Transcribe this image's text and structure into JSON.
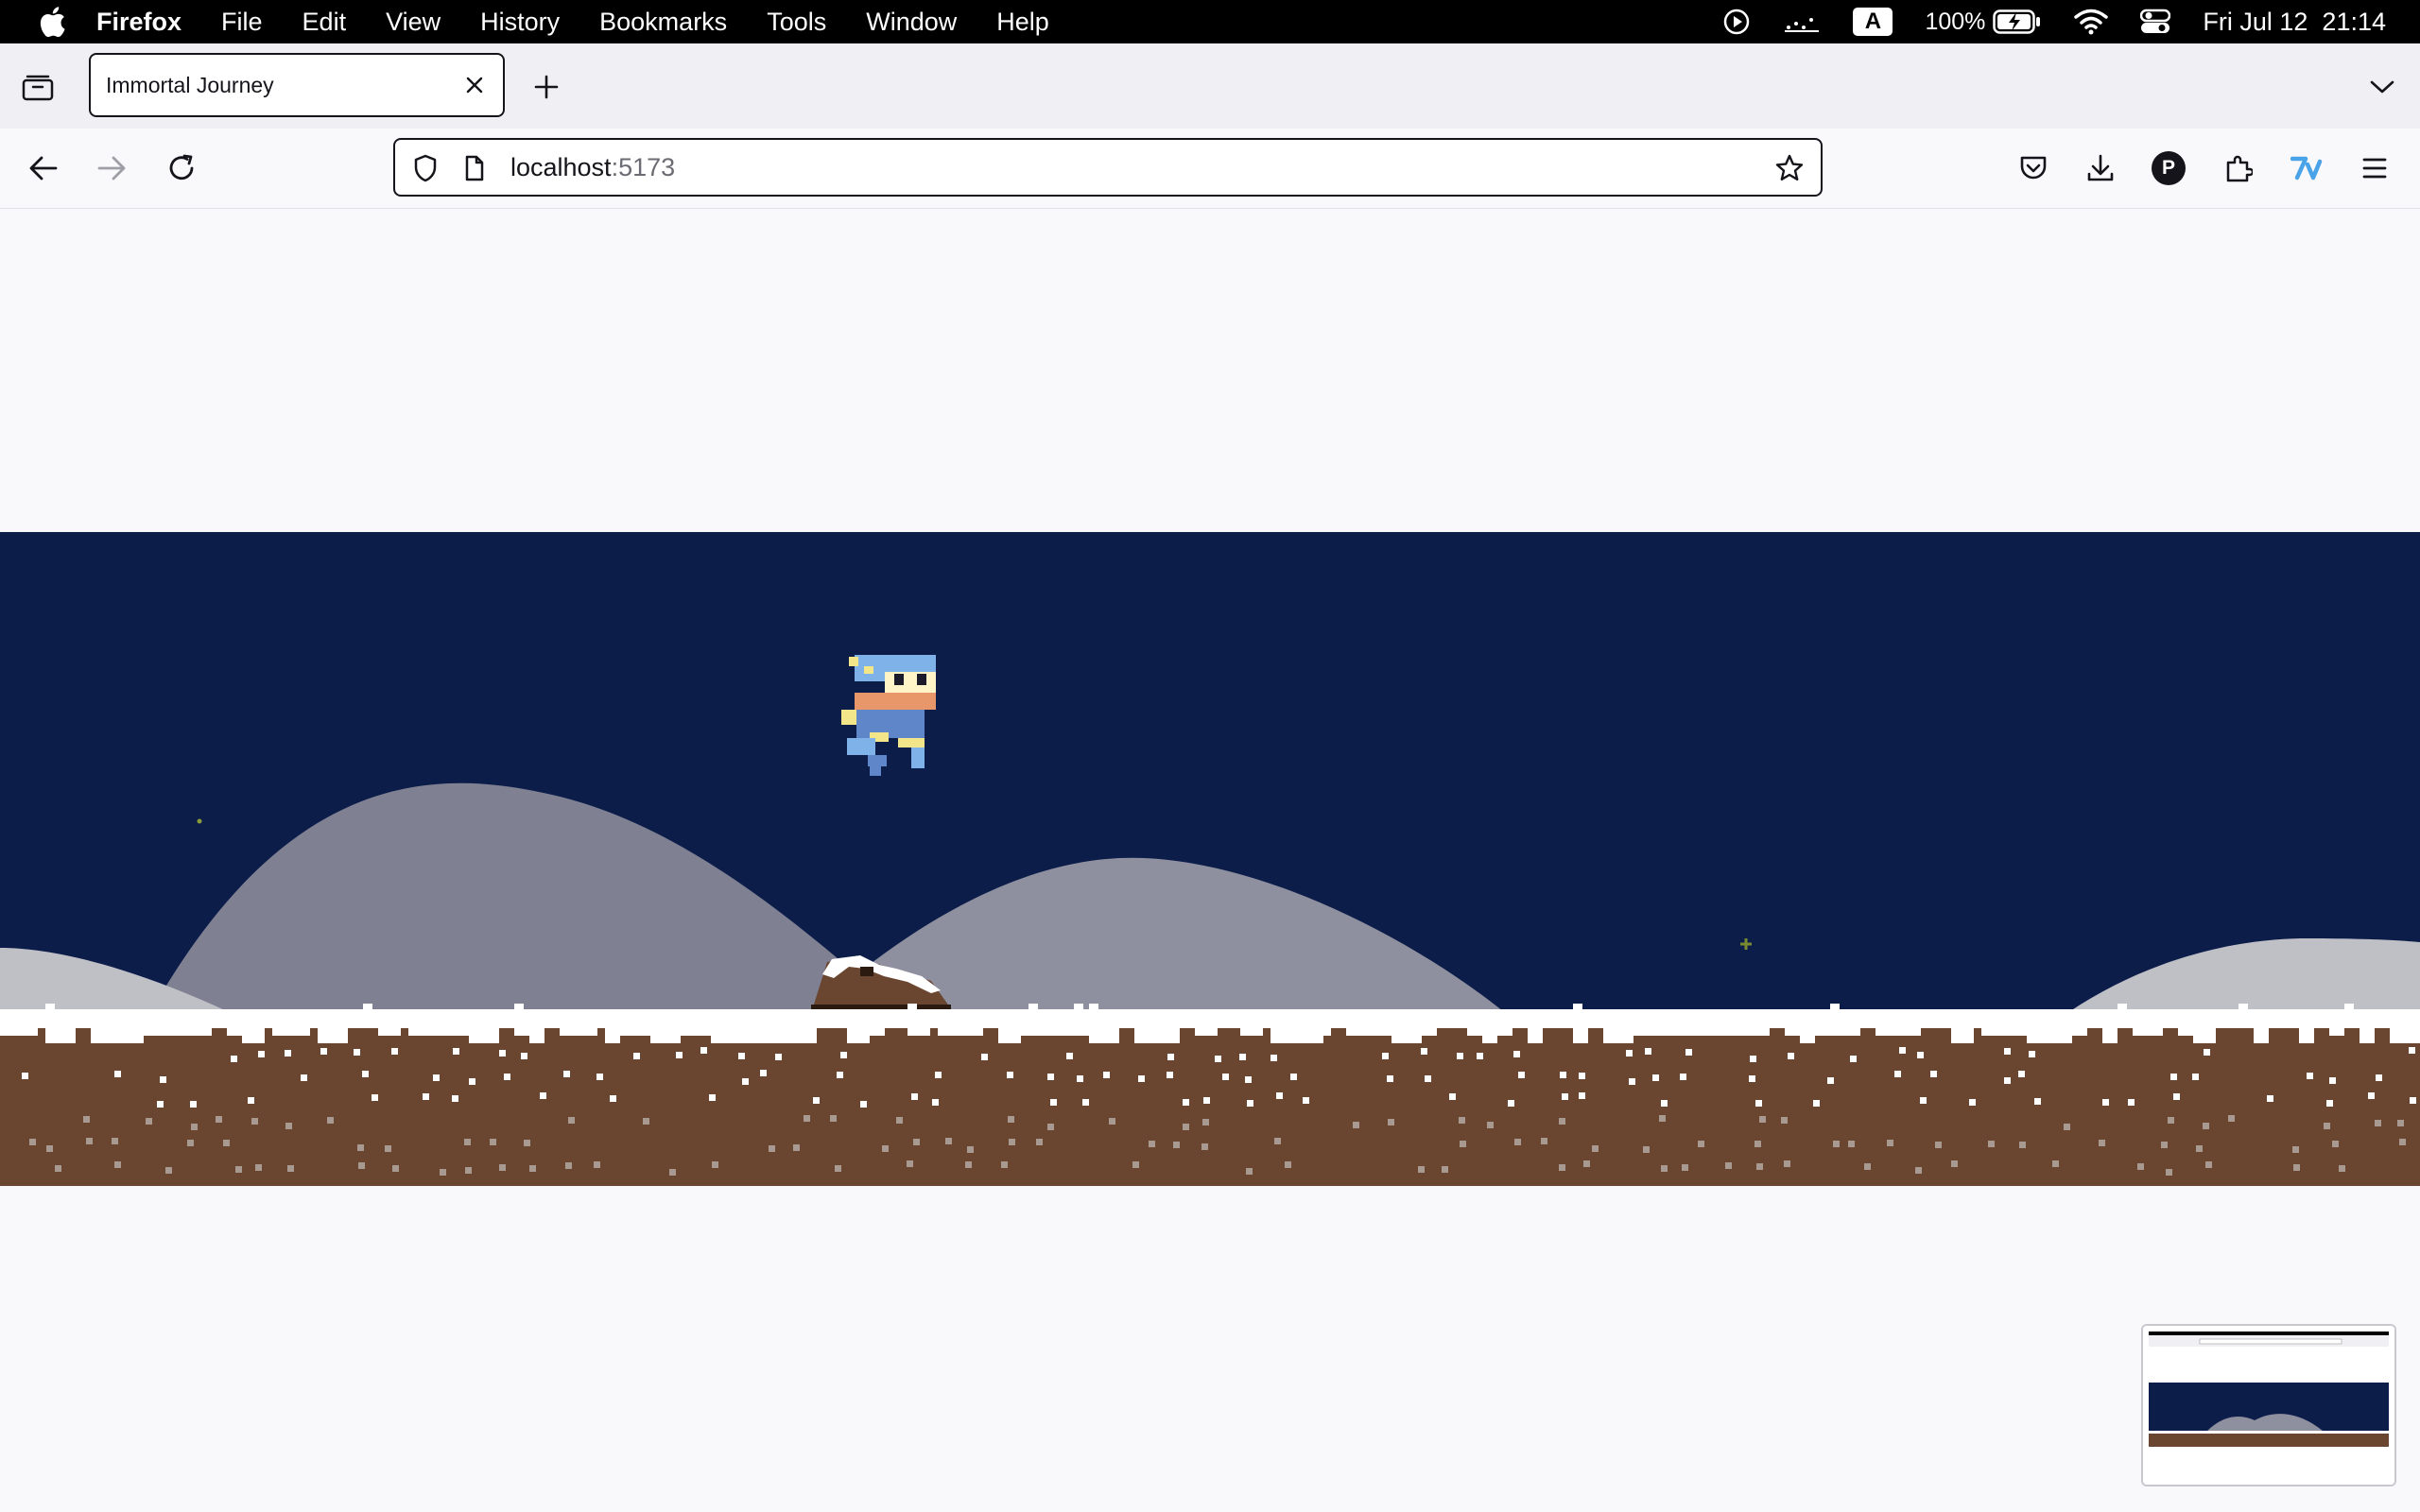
{
  "menubar": {
    "app": "Firefox",
    "items": [
      "File",
      "Edit",
      "View",
      "History",
      "Bookmarks",
      "Tools",
      "Window",
      "Help"
    ],
    "input_source": "A",
    "battery": "100%",
    "datetime": "Fri Jul 12  21:14"
  },
  "tabs": {
    "active_title": "Immortal Journey"
  },
  "urlbar": {
    "host": "localhost",
    "port": ":5173"
  },
  "toolbar": {
    "profile_initial": "P"
  },
  "colors": {
    "sky": "#0c1d4a",
    "hill_far": "#7f8193",
    "hill_near": "#8f909f",
    "hill_light": "#bfbfc6",
    "ground": "#6a4630",
    "snow": "#ffffff"
  }
}
